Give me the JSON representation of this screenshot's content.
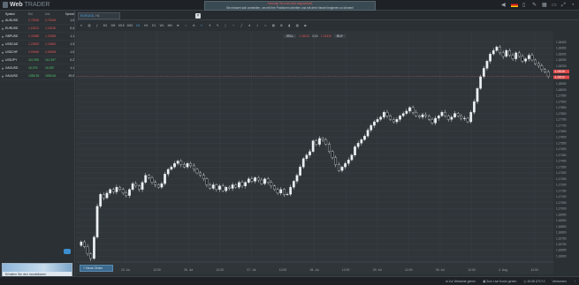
{
  "app": {
    "logo_main": "Web",
    "logo_sub": "TRADER"
  },
  "alert": {
    "line1": "Achtung! Sie sind nicht angemeldet!",
    "line2": "Sie müssen sich anmelden, um mit Ihre Positionen arbeiten und mit dem Handel beginnen zu können!"
  },
  "topbar_icons": [
    "sound-icon",
    "flag-icon",
    "mobile-icon",
    "edit-icon",
    "layout-icon",
    "window-icon",
    "fullscreen-icon",
    "chat-icon"
  ],
  "watchlist": {
    "headers": {
      "symbol": "Symbol",
      "bid": "Bid",
      "ask": "Ask",
      "spread": "Spread"
    },
    "rows": [
      {
        "symbol": "AUDUSD",
        "bid": "0,75155",
        "ask": "0,75165",
        "spread": "1,0",
        "dir": "down"
      },
      {
        "symbol": "EURUSD",
        "bid": "1,18112",
        "ask": "1,18116",
        "spread": "0,4",
        "dir": "down"
      },
      {
        "symbol": "GBPUSD",
        "bid": "1,33385",
        "ask": "1,33396",
        "spread": "1,1",
        "dir": "down"
      },
      {
        "symbol": "USDCAD",
        "bid": "1,24829",
        "ask": "1,24842",
        "spread": "1,3",
        "dir": "down"
      },
      {
        "symbol": "USDCHF",
        "bid": "0,99465",
        "ask": "0,99455",
        "spread": "1,0",
        "dir": "down"
      },
      {
        "symbol": "USDJPY",
        "bid": "110,395",
        "ask": "110,397",
        "spread": "0,2",
        "dir": "up"
      },
      {
        "symbol": "XAGUSD",
        "bid": "16,076",
        "ask": "16,087",
        "spread": "1,1",
        "dir": "up"
      },
      {
        "symbol": "XAUUSD",
        "bid": "1555,35",
        "ask": "1555,54",
        "spread": "19,0",
        "dir": "up"
      }
    ]
  },
  "promo": {
    "line1": "Erhalten Sie den handelbaren",
    "line2": "Schutz von bis zu 30%"
  },
  "tab": {
    "symbol": "EURUSD",
    "timeframe": "H1"
  },
  "toolbar": {
    "timeframes": [
      "M1",
      "M5",
      "M15",
      "M30",
      "H1",
      "H4",
      "D1",
      "W1",
      "MN"
    ],
    "active_timeframe": "H1"
  },
  "trade": {
    "sell_label": "SELL",
    "sell_price": "1,18112",
    "qty": "0,01",
    "buy_price": "1,18116",
    "buy_label": "BUY"
  },
  "new_order_label": "Neue Order",
  "status": {
    "link1": "Zur Webseite gehen",
    "link2": "Zum Live Konto gehen",
    "time": "15:48 UTC+2",
    "conn": "Verbunden"
  },
  "chart_data": {
    "type": "candlestick",
    "price_tags": {
      "bid": "1,18112",
      "ask": "1,18116"
    },
    "ylim": [
      1.1655,
      1.1848
    ],
    "y_ticks": [
      "1,18400",
      "1,18350",
      "1,18300",
      "1,18250",
      "1,18200",
      "1,18150",
      "1,18100",
      "1,18050",
      "1,18000",
      "1,17950",
      "1,17900",
      "1,17850",
      "1,17800",
      "1,17750",
      "1,17700",
      "1,17650",
      "1,17600",
      "1,17550",
      "1,17500",
      "1,17450",
      "1,17400",
      "1,17350",
      "1,17300",
      "1,17250",
      "1,17200",
      "1,17150",
      "1,17100",
      "1,17050",
      "1,17000",
      "1,16950",
      "1,16900",
      "1,16850",
      "1,16800",
      "1,16750",
      "1,16700",
      "1,16650",
      "1,16600"
    ],
    "x_ticks": [
      "23. Jul",
      "12:00",
      "26. Jul",
      "12:00",
      "27. Jul",
      "12:00",
      "28. Jul",
      "12:00",
      "29. Jul",
      "12:00",
      "30. Jul",
      "12:00",
      "2. Aug",
      "12:00"
    ],
    "closes": [
      1.1672,
      1.1668,
      1.1662,
      1.1658,
      1.1676,
      1.1702,
      1.1712,
      1.1709,
      1.1713,
      1.1716,
      1.1714,
      1.1718,
      1.1716,
      1.1713,
      1.1711,
      1.1716,
      1.1721,
      1.1719,
      1.1716,
      1.1722,
      1.1728,
      1.1726,
      1.1722,
      1.172,
      1.1718,
      1.1721,
      1.1729,
      1.1733,
      1.1735,
      1.1738,
      1.174,
      1.1737,
      1.1735,
      1.1738,
      1.1736,
      1.1733,
      1.173,
      1.1728,
      1.1725,
      1.172,
      1.1717,
      1.172,
      1.1716,
      1.1719,
      1.1715,
      1.1718,
      1.1717,
      1.172,
      1.1718,
      1.1722,
      1.1719,
      1.1722,
      1.1725,
      1.1723,
      1.1726,
      1.1724,
      1.1721,
      1.1725,
      1.1722,
      1.1719,
      1.1716,
      1.1713,
      1.1716,
      1.1712,
      1.1712,
      1.1718,
      1.1723,
      1.1728,
      1.1735,
      1.1742,
      1.1745,
      1.1748,
      1.1757,
      1.1754,
      1.1759,
      1.1758,
      1.1754,
      1.1748,
      1.1743,
      1.1737,
      1.1732,
      1.1735,
      1.1738,
      1.1741,
      1.1745,
      1.1752,
      1.1755,
      1.1758,
      1.1761,
      1.1766,
      1.177,
      1.1773,
      1.1775,
      1.1777,
      1.1781,
      1.1778,
      1.1775,
      1.1773,
      1.1775,
      1.1778,
      1.178,
      1.1782,
      1.1785,
      1.1781,
      1.1778,
      1.1777,
      1.1779,
      1.1778,
      1.1775,
      1.1772,
      1.1776,
      1.1778,
      1.1781,
      1.1778,
      1.1775,
      1.1777,
      1.178,
      1.1778,
      1.1776,
      1.1776,
      1.1773,
      1.1781,
      1.179,
      1.1801,
      1.1811,
      1.1818,
      1.1824,
      1.183,
      1.1833,
      1.1836,
      1.1831,
      1.1828,
      1.1833,
      1.1829,
      1.1826,
      1.1831,
      1.1828,
      1.1824,
      1.1826,
      1.1829,
      1.1825,
      1.1822,
      1.182,
      1.1817,
      1.1815,
      1.1811
    ]
  }
}
